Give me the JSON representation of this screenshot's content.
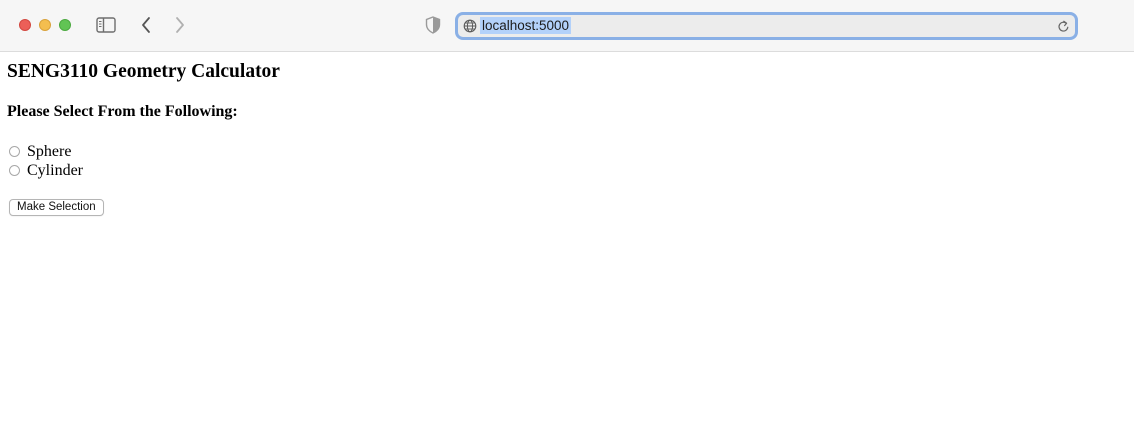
{
  "browser": {
    "url": "localhost:5000",
    "icons": {
      "sidebar": "sidebar-icon",
      "back": "chevron-left-icon",
      "forward": "chevron-right-icon",
      "privacy": "shield-icon",
      "globe": "globe-icon",
      "reload": "reload-icon"
    },
    "colors": {
      "close": "#ec5f58",
      "minimize": "#f4be4f",
      "zoom": "#61c454",
      "url_focus_ring": "#8ab0e6",
      "url_selection": "#b3d1fa"
    }
  },
  "page": {
    "title": "SENG3110 Geometry Calculator",
    "prompt": "Please Select From the Following:",
    "options": [
      {
        "label": "Sphere",
        "selected": false
      },
      {
        "label": "Cylinder",
        "selected": false
      }
    ],
    "submit_label": "Make Selection"
  }
}
